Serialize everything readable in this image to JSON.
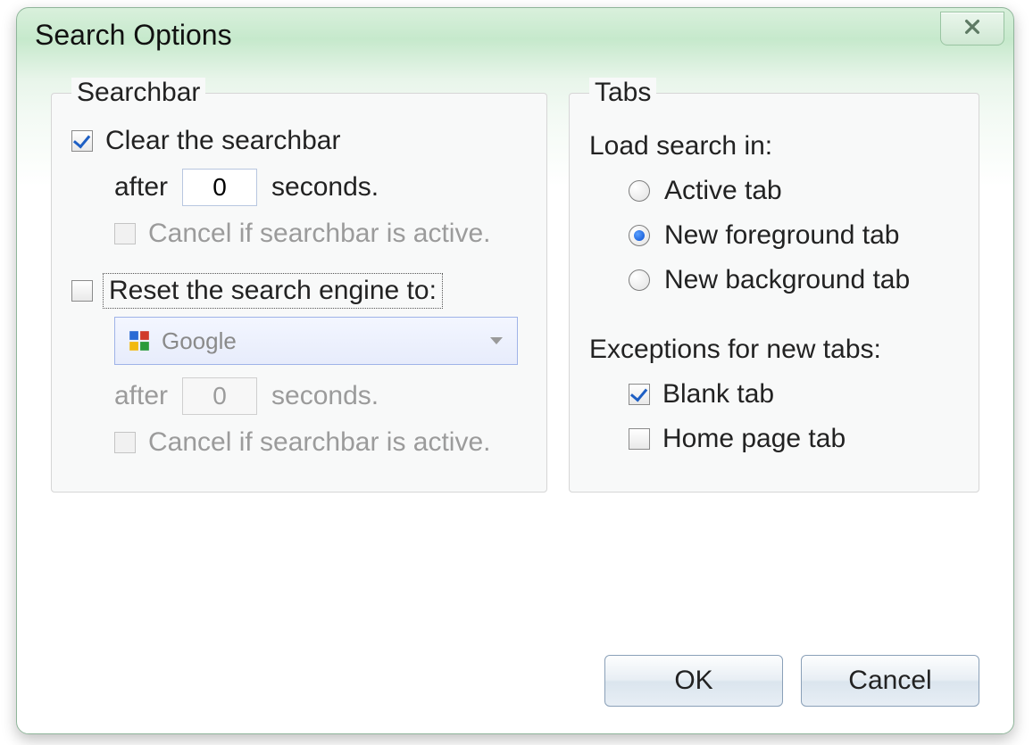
{
  "title": "Search Options",
  "searchbar": {
    "legend": "Searchbar",
    "clear_label": "Clear the searchbar",
    "clear_checked": true,
    "after_prefix": "after",
    "after_value": "0",
    "after_suffix": "seconds.",
    "cancel_label": "Cancel if searchbar is active.",
    "reset_label": "Reset the search engine to:",
    "reset_checked": false,
    "engine_selected": "Google",
    "reset_after_value": "0"
  },
  "tabs": {
    "legend": "Tabs",
    "load_heading": "Load search in:",
    "options": [
      {
        "label": "Active tab",
        "selected": false
      },
      {
        "label": "New foreground tab",
        "selected": true
      },
      {
        "label": "New background tab",
        "selected": false
      }
    ],
    "exceptions_heading": "Exceptions for new tabs:",
    "exceptions": [
      {
        "label": "Blank tab",
        "checked": true
      },
      {
        "label": "Home page tab",
        "checked": false
      }
    ]
  },
  "buttons": {
    "ok": "OK",
    "cancel": "Cancel"
  }
}
